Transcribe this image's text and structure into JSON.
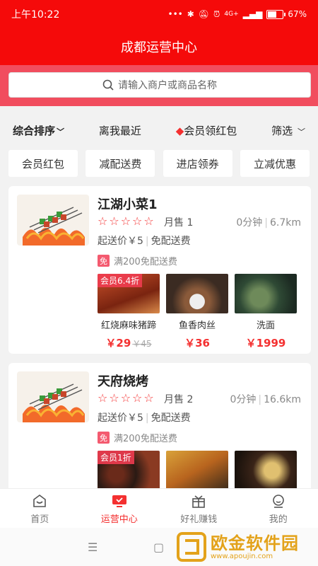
{
  "status": {
    "time": "上午10:22",
    "battery": "67%",
    "battery_level": 0.67,
    "network": "4G+"
  },
  "title": "成都运营中心",
  "search": {
    "placeholder": "请输入商户或商品名称"
  },
  "sort": {
    "items": [
      "综合排序",
      "离我最近",
      "会员领红包",
      "筛选"
    ]
  },
  "tags": [
    "会员红包",
    "减配送费",
    "进店领券",
    "立减优惠"
  ],
  "shops": [
    {
      "name": "江湖小菜1",
      "rating_stars": "☆☆☆☆☆",
      "sales": "月售 1",
      "time": "0分钟",
      "distance": "6.7km",
      "min_price": "起送价￥5",
      "delivery": "免配送费",
      "promo_badge": "免",
      "promo": "满200免配送费",
      "items": [
        {
          "discount": "会员6.4折",
          "name": "红烧麻味猪蹄",
          "price": "￥29",
          "old_price": "￥45"
        },
        {
          "name": "鱼香肉丝",
          "price": "￥36"
        },
        {
          "name": "洗面",
          "price": "￥1999"
        }
      ]
    },
    {
      "name": "天府烧烤",
      "rating_stars": "☆☆☆☆☆",
      "sales": "月售 2",
      "time": "0分钟",
      "distance": "16.6km",
      "min_price": "起送价￥5",
      "delivery": "免配送费",
      "promo_badge": "免",
      "promo": "满200免配送费",
      "items": [
        {
          "discount": "会员1折"
        },
        {},
        {}
      ]
    }
  ],
  "tabbar": [
    "首页",
    "运营中心",
    "好礼赚钱",
    "我的"
  ],
  "watermark": {
    "text": "欧金软件园",
    "url": "www.apoujin.com"
  },
  "colors": {
    "brand_red": "#f50a0a",
    "price_red": "#f43030",
    "search_bg": "#f14d5e",
    "watermark": "#e3a21a"
  }
}
